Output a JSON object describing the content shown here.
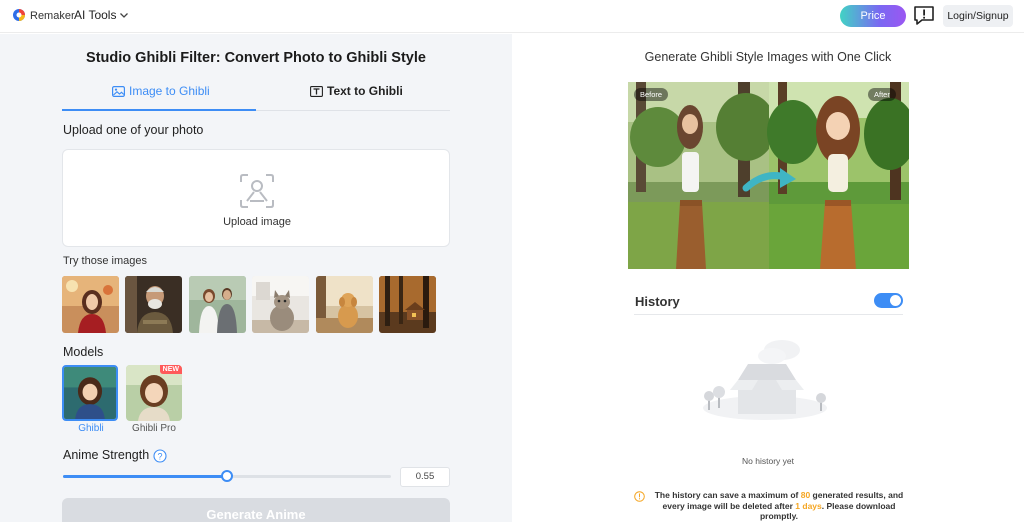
{
  "header": {
    "brand": "Remaker",
    "ai_tools": "AI Tools",
    "price": "Price",
    "login": "Login/Signup"
  },
  "left": {
    "title": "Studio Ghibli Filter: Convert Photo to Ghibli Style",
    "tabs": [
      {
        "label": "Image to Ghibli",
        "active": true
      },
      {
        "label": "Text to Ghibli",
        "active": false
      }
    ],
    "upload_label": "Upload one of your photo",
    "upload_text": "Upload image",
    "try_label": "Try those images",
    "try_images": [
      "woman-red-shirt",
      "old-man",
      "couple",
      "cat",
      "golden-dog",
      "forest-cabin"
    ],
    "models_label": "Models",
    "models": [
      {
        "name": "Ghibli",
        "selected": true,
        "badge": ""
      },
      {
        "name": "Ghibli Pro",
        "selected": false,
        "badge": "NEW"
      }
    ],
    "strength_label": "Anime Strength",
    "strength_value": "0.55",
    "strength_fraction": 0.5,
    "generate": "Generate Anime"
  },
  "right": {
    "title": "Generate Ghibli Style Images with One Click",
    "before": "Before",
    "after": "After",
    "history": "History",
    "history_enabled": true,
    "no_history": "No history yet",
    "notice": {
      "part1": "The history can save a maximum of ",
      "max": "80",
      "part2": " generated results, and every image will be deleted after ",
      "days": "1 days",
      "part3": ". Please download promptly."
    }
  },
  "colors": {
    "accent": "#3d8df5",
    "warning": "#f5a623",
    "panel_bg": "#f3f5f8"
  }
}
